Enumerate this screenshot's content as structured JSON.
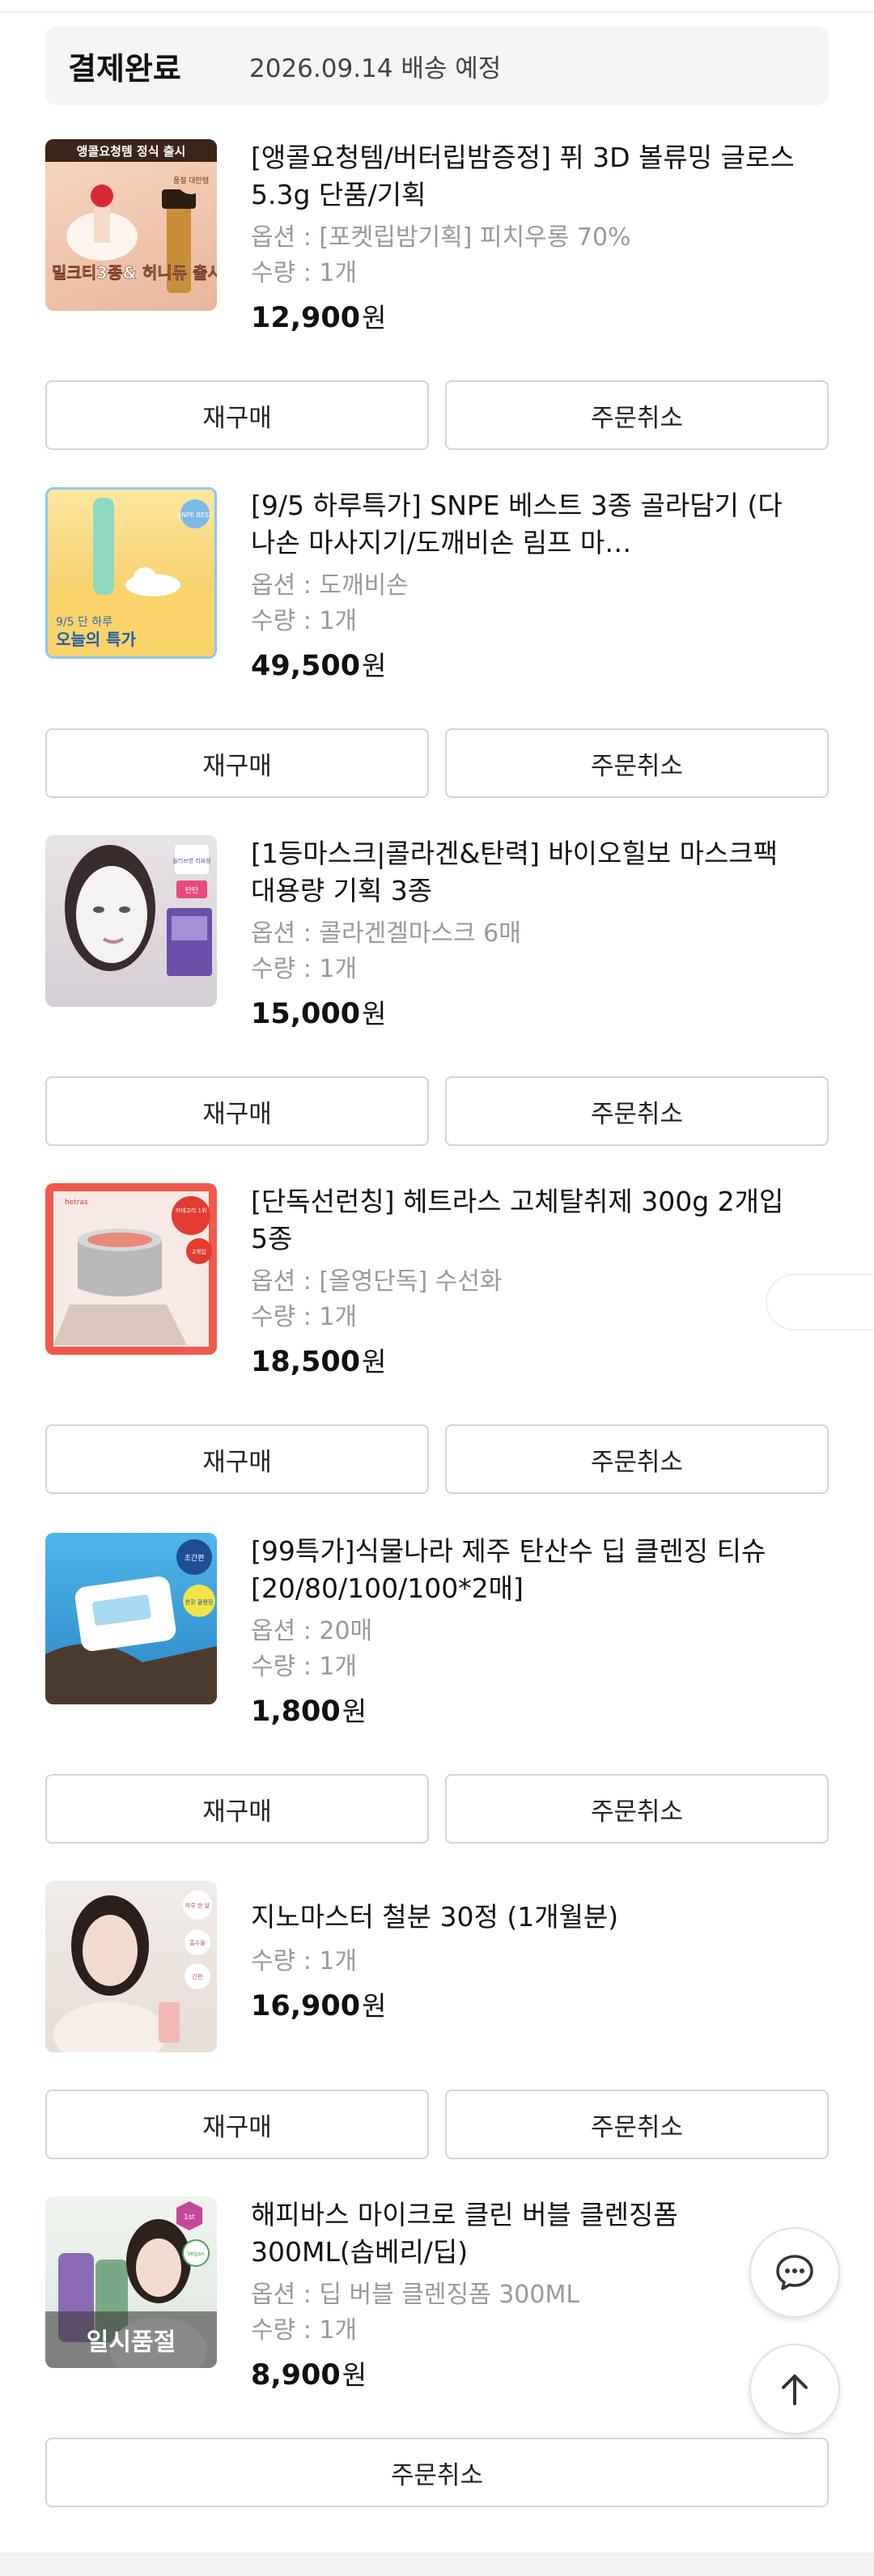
{
  "status": {
    "label": "결제완료",
    "delivery": "2026.09.14 배송 예정"
  },
  "labels": {
    "rebuy": "재구매",
    "cancel": "주문취소",
    "won": "원",
    "sold_out": "일시품절"
  },
  "orders": [
    {
      "name": "[앵콜요청템/버터립밤증정] 퓌 3D 볼류밍 글로스 5.3g 단품/기획",
      "option": "옵션 : [포켓립밤기획] 피치우롱 70%",
      "qty": "수량 : 1개",
      "price": "12,900",
      "thumb_texts": [
        "앵콜요청템 정식 출시",
        "밀크티3종& 허니듀 출시!",
        "품절 대란템"
      ]
    },
    {
      "name": "[9/5 하루특가] SNPE 베스트 3종 골라담기 (다나손 마사지기/도깨비손 림프 마…",
      "option": "옵션 : 도깨비손",
      "qty": "수량 : 1개",
      "price": "49,500",
      "thumb_texts": [
        "9/5 단 하루",
        "오늘의 특가",
        "SNPE BEST"
      ]
    },
    {
      "name": "[1등마스크|콜라겐&탄력] 바이오힐보 마스크팩 대용량 기획 3종",
      "option": "옵션 : 콜라겐겔마스크 6매",
      "qty": "수량 : 1개",
      "price": "15,000",
      "thumb_texts": [
        "올리브영 리뷰왕",
        "탄탄"
      ]
    },
    {
      "name": "[단독선런칭] 헤트라스 고체탈취제 300g 2개입 5종",
      "option": "옵션 : [올영단독] 수선화",
      "qty": "수량 : 1개",
      "price": "18,500",
      "thumb_texts": [
        "hetras",
        "카테고리 1위",
        "2개입"
      ]
    },
    {
      "name": "[99특가]식물나라 제주 탄산수 딥 클렌징 티슈 [20/80/100/100*2매]",
      "option": "옵션 : 20매",
      "qty": "수량 : 1개",
      "price": "1,800",
      "thumb_texts": [
        "초간편",
        "한장 클렌징"
      ]
    },
    {
      "name": "지노마스터 철분 30정 (1개월분)",
      "qty": "수량 : 1개",
      "price": "16,900",
      "thumb_texts": [
        "하루 한 알",
        "흡수율",
        "간편"
      ]
    },
    {
      "name": "해피바스 마이크로 클린 버블 클렌징폼 300ML(솝베리/딥)",
      "option": "옵션 : 딥 버블 클렌징폼 300ML",
      "qty": "수량 : 1개",
      "price": "8,900",
      "thumb_texts": [
        "1st",
        "Vegan"
      ]
    }
  ]
}
